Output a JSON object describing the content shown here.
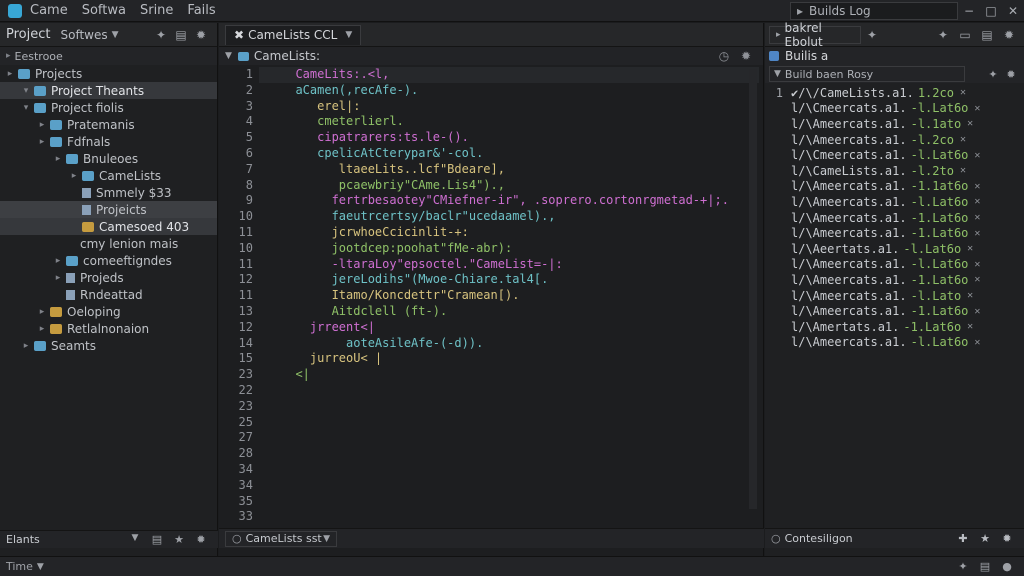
{
  "menu": [
    "Came",
    "Softwa",
    "Srine",
    "Fails"
  ],
  "window": {
    "title": "Builds Log",
    "buttons": [
      "−",
      "□",
      "✕"
    ]
  },
  "left": {
    "toolbar_title": "Project",
    "toolbar_dropdown": "Softwes",
    "crumb": "Eestrooe",
    "tree": [
      {
        "label": "Projects",
        "level": 0,
        "arrow": "▸",
        "icon": "folder",
        "sel": ""
      },
      {
        "label": "Project Theants",
        "level": 1,
        "arrow": "▾",
        "icon": "folder",
        "sel": "sel"
      },
      {
        "label": "Project fiolis",
        "level": 1,
        "arrow": "▾",
        "icon": "folder",
        "sel": ""
      },
      {
        "label": "Pratemanis",
        "level": 2,
        "arrow": "▸",
        "icon": "folder",
        "sel": ""
      },
      {
        "label": "Fdfnals",
        "level": 2,
        "arrow": "▸",
        "icon": "folder",
        "sel": ""
      },
      {
        "label": "Bnuleoes",
        "level": 3,
        "arrow": "▸",
        "icon": "folder",
        "sel": ""
      },
      {
        "label": "CameLists",
        "level": 4,
        "arrow": "▸",
        "icon": "folder",
        "sel": ""
      },
      {
        "label": "Smmely $33",
        "level": 4,
        "arrow": "",
        "icon": "file",
        "sel": ""
      },
      {
        "label": "Projeicts",
        "level": 4,
        "arrow": "",
        "icon": "file",
        "sel": "sel2"
      },
      {
        "label": "Camesoed 403",
        "level": 4,
        "arrow": "",
        "icon": "foldery",
        "sel": "sel"
      },
      {
        "label": "cmy lenion mais",
        "level": 4,
        "arrow": "",
        "icon": "none",
        "sel": ""
      },
      {
        "label": "comeeftigndes",
        "level": 3,
        "arrow": "▸",
        "icon": "folder",
        "sel": ""
      },
      {
        "label": "Projeds",
        "level": 3,
        "arrow": "▸",
        "icon": "file",
        "sel": ""
      },
      {
        "label": "Rndeattad",
        "level": 3,
        "arrow": "",
        "icon": "file",
        "sel": ""
      },
      {
        "label": "Oeloping",
        "level": 2,
        "arrow": "▸",
        "icon": "foldery",
        "sel": ""
      },
      {
        "label": "Retlalnonaion",
        "level": 2,
        "arrow": "▸",
        "icon": "foldery",
        "sel": ""
      },
      {
        "label": "Seamts",
        "level": 1,
        "arrow": "▸",
        "icon": "folder",
        "sel": ""
      }
    ],
    "bottom_label": "Elants"
  },
  "editor": {
    "tab_label": "CameLists CCL",
    "subtab_label": "CameLists:",
    "line_numbers": [
      "1",
      "2",
      "3",
      "4",
      "5",
      "6",
      "7",
      "8",
      "9",
      "10",
      "11",
      "10",
      "11",
      "12",
      "11",
      "13",
      "12",
      "14",
      "15",
      "23",
      "22",
      "23",
      "25",
      "27",
      "28",
      "34",
      "34",
      "35",
      "33"
    ],
    "lines": [
      "  CameLits:.<l,",
      "  aCamen(,recAfe-).",
      "     erel|:",
      "     cmeterlierl.",
      "     cipatrarers:ts.le-().",
      "     cpelicAtCterypar&'-col.",
      "        ltaeeLits..lcf\"Bdeare],",
      "        pcaewbriy\"CAme.Lis4\").,",
      "       fertrbesaotey\"CMiefner-ir\", .soprero.cortonrgmetad-+|;.",
      "       faeutrcertsy/baclr\"ucedaamel).,",
      "       jcrwhoeCcicinlit-+:",
      "       jootdcep:poohat\"fMe-abr):",
      "       -ltaraLoy\"epsoctel.\"CameList=-|:",
      "       jereLodihs\"(Mwoe-Chiare.tal4[.",
      "       Itamo/Koncdettr\"Cramean[).",
      "       Aitdclell (ft-).",
      "    jrreent<|",
      "         aoteAsileAfe-(-d)).",
      "    jurreoU< |",
      "  <|",
      "",
      "",
      "",
      "",
      "",
      "",
      "",
      "",
      ""
    ],
    "bottom_dropdown": "CameLists sst"
  },
  "right": {
    "toolbar_box": "bakrel Ebolut",
    "toolbar_title": "Builis a",
    "filter_text": "Build baen Rosy",
    "log_first": {
      "num": "1",
      "key": "✔/\\/CameLists.a1.",
      "val": "1.2co",
      "mark": "✕"
    },
    "log_rows": [
      {
        "key": "l/\\Cmeercats.a1.",
        "val": "-l.Lat6o",
        "mark": "✕"
      },
      {
        "key": "l/\\Ameercats.a1.",
        "val": "-l.1ato",
        "mark": "✕"
      },
      {
        "key": "l/\\Ameercats.a1.",
        "val": "-l.2co",
        "mark": "✕"
      },
      {
        "key": "l/\\Cmeercats.a1.",
        "val": "-l.Lat6o",
        "mark": "✕"
      },
      {
        "key": "l/\\CameLists.a1.",
        "val": "-l.2to",
        "mark": "✕"
      },
      {
        "key": "l/\\Ameercats.a1.",
        "val": "-1.1at6o",
        "mark": "✕"
      },
      {
        "key": "l/\\Ameercats.a1.",
        "val": "-l.Lat6o",
        "mark": "✕"
      },
      {
        "key": "l/\\Ameercats.a1.",
        "val": "-1.Lat6o",
        "mark": "✕"
      },
      {
        "key": "l/\\Ameercats.a1.",
        "val": "-1.Lat6o",
        "mark": "✕"
      },
      {
        "key": "l/\\Aeertats.a1.",
        "val": "-l.Lat6o",
        "mark": "✕"
      },
      {
        "key": "l/\\Ameercats.a1.",
        "val": "-l.Lat6o",
        "mark": "✕"
      },
      {
        "key": "l/\\Ameercats.a1.",
        "val": "-1.Lat6o",
        "mark": "✕"
      },
      {
        "key": "l/\\Ameercats.a1.",
        "val": "-l.Lato",
        "mark": "✕"
      },
      {
        "key": "l/\\Ameercats.a1.",
        "val": "-1.Lat6o",
        "mark": "✕"
      },
      {
        "key": "l/\\Amertats.a1.",
        "val": "-1.Lat6o",
        "mark": "✕"
      },
      {
        "key": "l/\\Ameercats.a1.",
        "val": "-l.Lat6o",
        "mark": "✕"
      }
    ],
    "bottom_label": "Contesiligon"
  },
  "status": {
    "label": "Time"
  },
  "colors": {
    "accent": "#38a7d6",
    "folder": "#5aa0c8",
    "folder_yellow": "#c59b3f",
    "log_value": "#8fc167"
  }
}
